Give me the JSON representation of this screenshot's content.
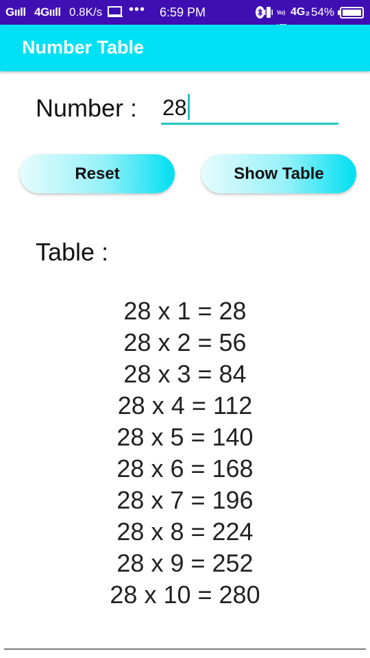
{
  "status_bar": {
    "signal1": "Gııll",
    "signal2": "4Gııll",
    "speed": "0.8K/s",
    "dots": "•••",
    "time": "6:59 PM",
    "volte_top": "Vo)",
    "volte_bottom": "LTE",
    "network": "4G₂",
    "battery_pct": "54%"
  },
  "app_bar": {
    "title": "Number Table"
  },
  "form": {
    "number_label": "Number :",
    "number_value": "28"
  },
  "buttons": {
    "reset_label": "Reset",
    "show_table_label": "Show Table"
  },
  "table": {
    "label": "Table  :",
    "rows": [
      "28 x 1 = 28",
      "28 x 2 = 56",
      "28 x 3 = 84",
      "28 x 4 = 112",
      "28 x 5 = 140",
      "28 x 6 = 168",
      "28 x 7 = 196",
      "28 x 8 = 224",
      "28 x 9 = 252",
      "28 x 10 = 280"
    ]
  },
  "colors": {
    "status_bar": "#3f0fb4",
    "app_bar": "#00e0f4",
    "accent": "#1fc6c6"
  }
}
